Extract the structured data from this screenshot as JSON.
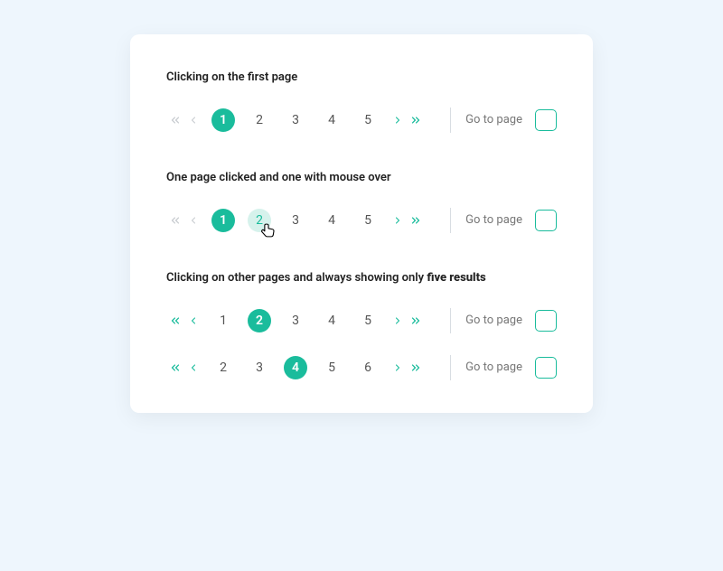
{
  "colors": {
    "accent": "#1abc9c",
    "accent_light": "#d6f2ec",
    "page_bg": "#eef6fd",
    "card_bg": "#ffffff",
    "disabled_icon": "#c8ccd0"
  },
  "sections": [
    {
      "title_plain": "Clicking on the first page",
      "title_bold": "",
      "rows": [
        {
          "prev_disabled": true,
          "pages": [
            "1",
            "2",
            "3",
            "4",
            "5"
          ],
          "active_index": 0,
          "hover_index": -1,
          "goto_label": "Go to page",
          "goto_value": "",
          "show_cursor": false
        }
      ]
    },
    {
      "title_plain": "One page clicked and one with mouse over",
      "title_bold": "",
      "rows": [
        {
          "prev_disabled": true,
          "pages": [
            "1",
            "2",
            "3",
            "4",
            "5"
          ],
          "active_index": 0,
          "hover_index": 1,
          "goto_label": "Go to page",
          "goto_value": "",
          "show_cursor": true
        }
      ]
    },
    {
      "title_plain": "Clicking on other pages and always showing only ",
      "title_bold": "five results",
      "rows": [
        {
          "prev_disabled": false,
          "pages": [
            "1",
            "2",
            "3",
            "4",
            "5"
          ],
          "active_index": 1,
          "hover_index": -1,
          "goto_label": "Go to page",
          "goto_value": "",
          "show_cursor": false
        },
        {
          "prev_disabled": false,
          "pages": [
            "2",
            "3",
            "4",
            "5",
            "6"
          ],
          "active_index": 2,
          "hover_index": -1,
          "goto_label": "Go to page",
          "goto_value": "",
          "show_cursor": false
        }
      ]
    }
  ]
}
